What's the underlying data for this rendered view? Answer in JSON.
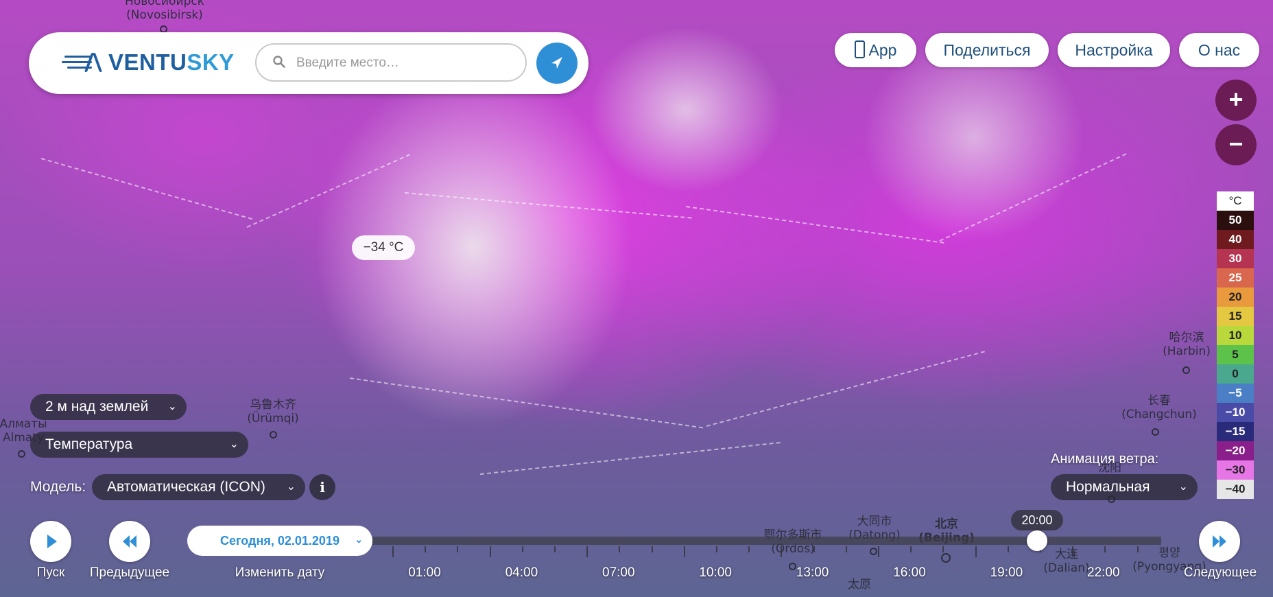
{
  "app": {
    "logo_part1": "VENTU",
    "logo_part2": "SKY"
  },
  "search": {
    "placeholder": "Введите место…"
  },
  "top_nav": {
    "app_label": "App",
    "share_label": "Поделиться",
    "settings_label": "Настройка",
    "about_label": "О нас"
  },
  "zoom": {
    "in_label": "+",
    "out_label": "−"
  },
  "legend": {
    "unit": "°C",
    "items": [
      {
        "value": "50",
        "bg": "#2b0e0e",
        "fg": "#ffffff"
      },
      {
        "value": "40",
        "bg": "#6e1a1e",
        "fg": "#ffffff"
      },
      {
        "value": "30",
        "bg": "#b53452",
        "fg": "#ffffff"
      },
      {
        "value": "25",
        "bg": "#d9674e",
        "fg": "#ffffff"
      },
      {
        "value": "20",
        "bg": "#e89a3c",
        "fg": "#222222"
      },
      {
        "value": "15",
        "bg": "#e4c842",
        "fg": "#222222"
      },
      {
        "value": "10",
        "bg": "#b8d83c",
        "fg": "#222222"
      },
      {
        "value": "5",
        "bg": "#5cc24a",
        "fg": "#222222"
      },
      {
        "value": "0",
        "bg": "#49a88e",
        "fg": "#222222"
      },
      {
        "value": "−5",
        "bg": "#4a7fc6",
        "fg": "#ffffff"
      },
      {
        "value": "−10",
        "bg": "#4a4ba6",
        "fg": "#ffffff"
      },
      {
        "value": "−15",
        "bg": "#2a2a7a",
        "fg": "#ffffff"
      },
      {
        "value": "−20",
        "bg": "#8a1e8a",
        "fg": "#ffffff"
      },
      {
        "value": "−30",
        "bg": "#e676e6",
        "fg": "#222222"
      },
      {
        "value": "−40",
        "bg": "#e6e6e6",
        "fg": "#222222"
      }
    ]
  },
  "map": {
    "temp_bubble": "−34 °C",
    "labels": {
      "novosibirsk": "(Novosibirsk)",
      "novosibirsk_local": "Новосибирск",
      "urumqi_local": "乌鲁木齐",
      "urumqi": "(Ürümqi)",
      "almaty_local": "Алматы",
      "almaty": "Almaty",
      "harbin_local": "哈尔滨",
      "harbin": "(Harbin)",
      "changchun_local": "长春",
      "changchun": "(Changchun)",
      "ordos_local": "鄂尔多斯市",
      "ordos": "(Ordos)",
      "datong_local": "大同市",
      "datong": "(Datong)",
      "beijing_local": "北京",
      "beijing": "(Beijing)",
      "dalian_local": "大连",
      "dalian": "(Dalian)",
      "pyongyang_local": "평양",
      "pyongyang": "(Pyongyang)",
      "shenyang_local": "沈阳",
      "taiyuan_local": "太原"
    }
  },
  "controls": {
    "level_select": "2 м над землей",
    "layer_select": "Температура",
    "model_label": "Модель:",
    "model_select": "Автоматическая (ICON)",
    "info": "i",
    "wind_label": "Анимация ветра:",
    "wind_select": "Нормальная"
  },
  "timeline": {
    "play_label": "Пуск",
    "prev_label": "Предыдущее",
    "date_button": "Сегодня, 02.01.2019",
    "change_date_label": "Изменить дату",
    "next_label": "Следующее",
    "current_time": "20:00",
    "hours": [
      "01:00",
      "04:00",
      "07:00",
      "10:00",
      "13:00",
      "16:00",
      "19:00",
      "22:00"
    ]
  }
}
